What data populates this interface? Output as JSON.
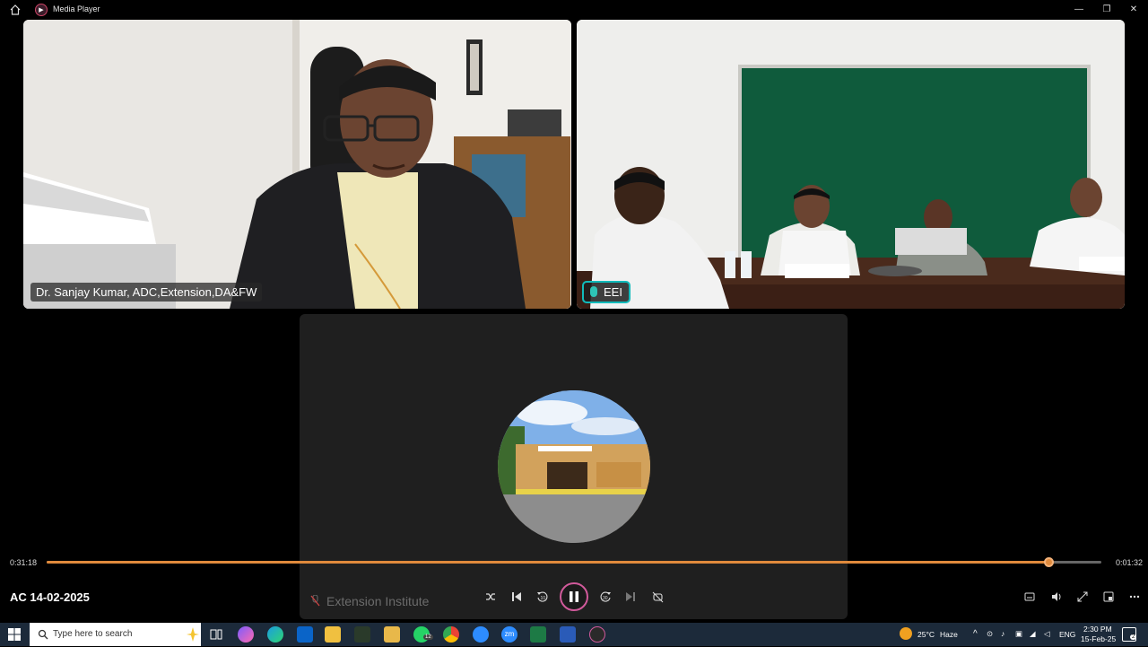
{
  "window": {
    "title": "Media Player"
  },
  "participants": {
    "left_name": "Dr. Sanjay Kumar, ADC,Extension,DA&FW",
    "right_name": "EEI",
    "bottom_name": "Extension Institute"
  },
  "player": {
    "elapsed": "0:31:18",
    "remaining": "0:01:32",
    "progress_fraction": 0.95,
    "now_playing": "AC 14-02-2025",
    "accent_color": "#e08a3c"
  },
  "taskbar": {
    "search_placeholder": "Type here to search",
    "weather": "25°C",
    "weather_desc": "Haze",
    "language": "ENG",
    "time": "2:30 PM",
    "date": "15-Feb-25",
    "whatsapp_badge": "12",
    "notification_count": "2"
  },
  "icons": [
    "home-icon",
    "media-player-icon",
    "minimize-icon",
    "restore-icon",
    "close-icon",
    "shuffle-icon",
    "previous-icon",
    "rewind-10-icon",
    "pause-icon",
    "forward-30-icon",
    "next-icon",
    "repeat-off-icon",
    "captions-icon",
    "volume-icon",
    "fullscreen-icon",
    "miniplayer-icon",
    "more-icon"
  ]
}
